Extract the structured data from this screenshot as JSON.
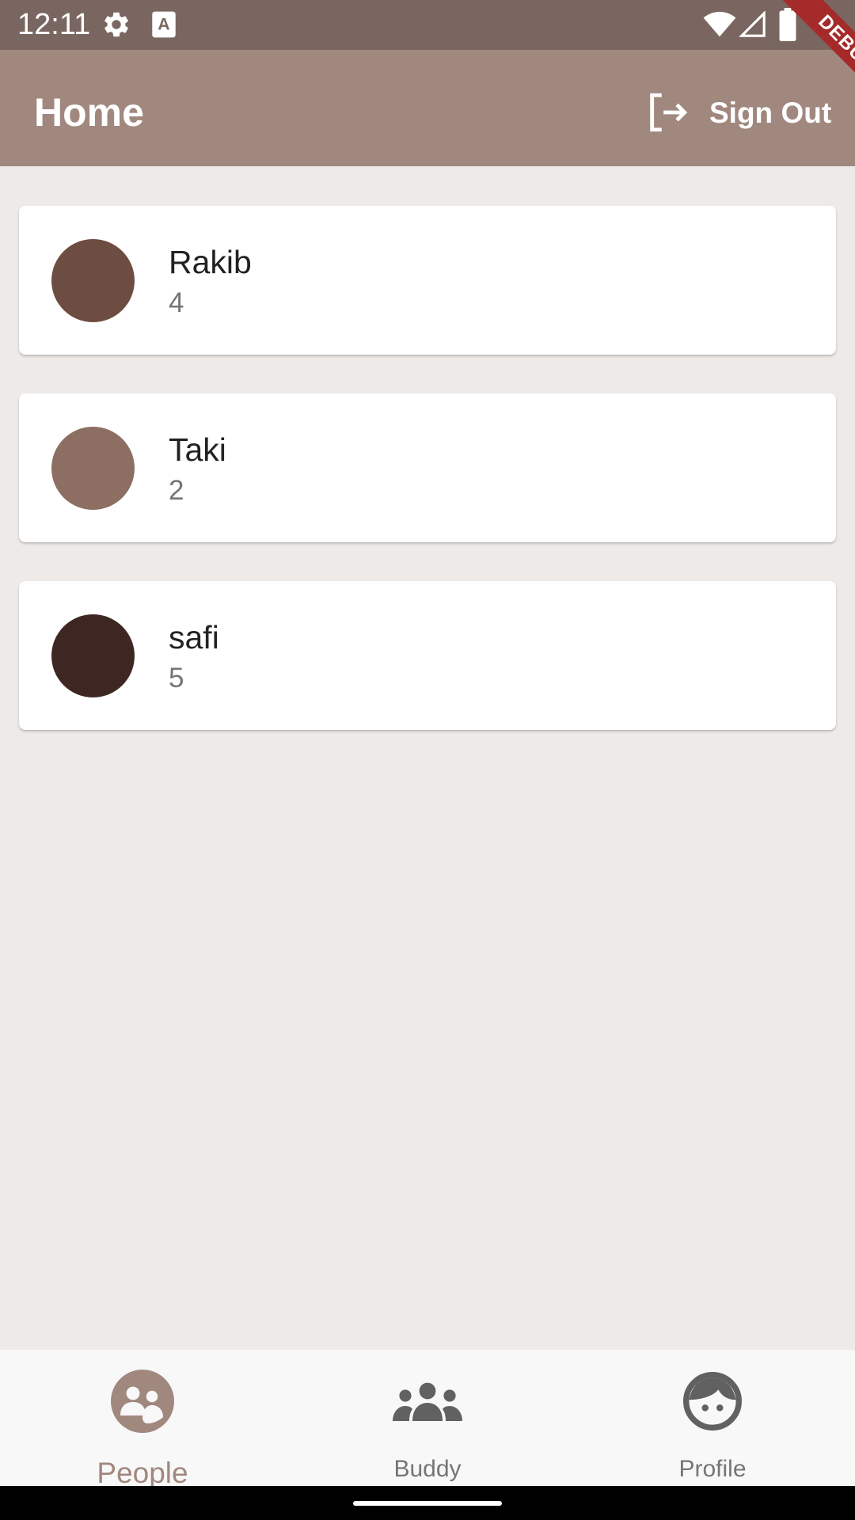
{
  "status_bar": {
    "time": "12:11",
    "icons": [
      "settings-icon",
      "text-a-icon",
      "wifi-icon",
      "signal-icon",
      "battery-icon"
    ]
  },
  "debug_banner": "DEBUG",
  "app_bar": {
    "title": "Home",
    "sign_out_label": "Sign Out",
    "sign_out_icon": "logout-icon"
  },
  "people": [
    {
      "name": "Rakib",
      "count": "4",
      "avatar_color": "#6D4C41"
    },
    {
      "name": "Taki",
      "count": "2",
      "avatar_color": "#8D6E63"
    },
    {
      "name": "safi",
      "count": "5",
      "avatar_color": "#3E2723"
    }
  ],
  "bottom_nav": {
    "items": [
      {
        "label": "People",
        "icon": "people-icon",
        "selected": true
      },
      {
        "label": "Buddy",
        "icon": "group-icon",
        "selected": false
      },
      {
        "label": "Profile",
        "icon": "face-icon",
        "selected": false
      }
    ]
  },
  "colors": {
    "status_bar": "#7A6660",
    "app_bar": "#A1887F",
    "background": "#EEEAE8",
    "accent": "#A1887F",
    "inactive": "#757575"
  }
}
